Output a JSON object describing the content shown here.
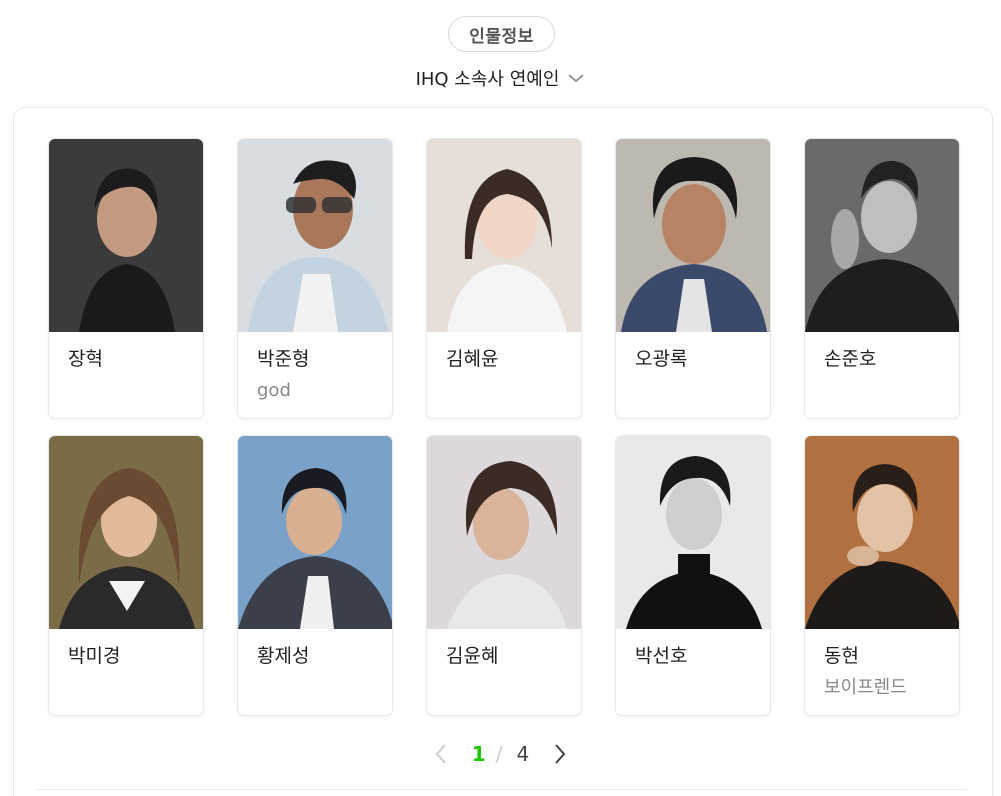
{
  "header": {
    "pill_label": "인물정보",
    "subtitle": "IHQ 소속사 연예인"
  },
  "cards": [
    {
      "name": "장혁",
      "group": "",
      "bg": "#3a3a3a"
    },
    {
      "name": "박준형",
      "group": "god",
      "bg": "#cfd8e0"
    },
    {
      "name": "김혜윤",
      "group": "",
      "bg": "#e8e2dc"
    },
    {
      "name": "오광록",
      "group": "",
      "bg": "#b7b2aa"
    },
    {
      "name": "손준호",
      "group": "",
      "bg": "#5c5c5c"
    },
    {
      "name": "박미경",
      "group": "",
      "bg": "#8a7a55"
    },
    {
      "name": "황제성",
      "group": "",
      "bg": "#7fa6c9"
    },
    {
      "name": "김윤혜",
      "group": "",
      "bg": "#d9d4d6"
    },
    {
      "name": "박선호",
      "group": "",
      "bg": "#e5e5e5"
    },
    {
      "name": "동현",
      "group": "보이프렌드",
      "bg": "#a36a3d"
    }
  ],
  "pagination": {
    "current": "1",
    "separator": "/",
    "total": "4"
  },
  "colors": {
    "accent": "#1ec800"
  },
  "icons": {
    "dropdown": "chevron-down-icon",
    "prev": "chevron-left-icon",
    "next": "chevron-right-icon"
  }
}
